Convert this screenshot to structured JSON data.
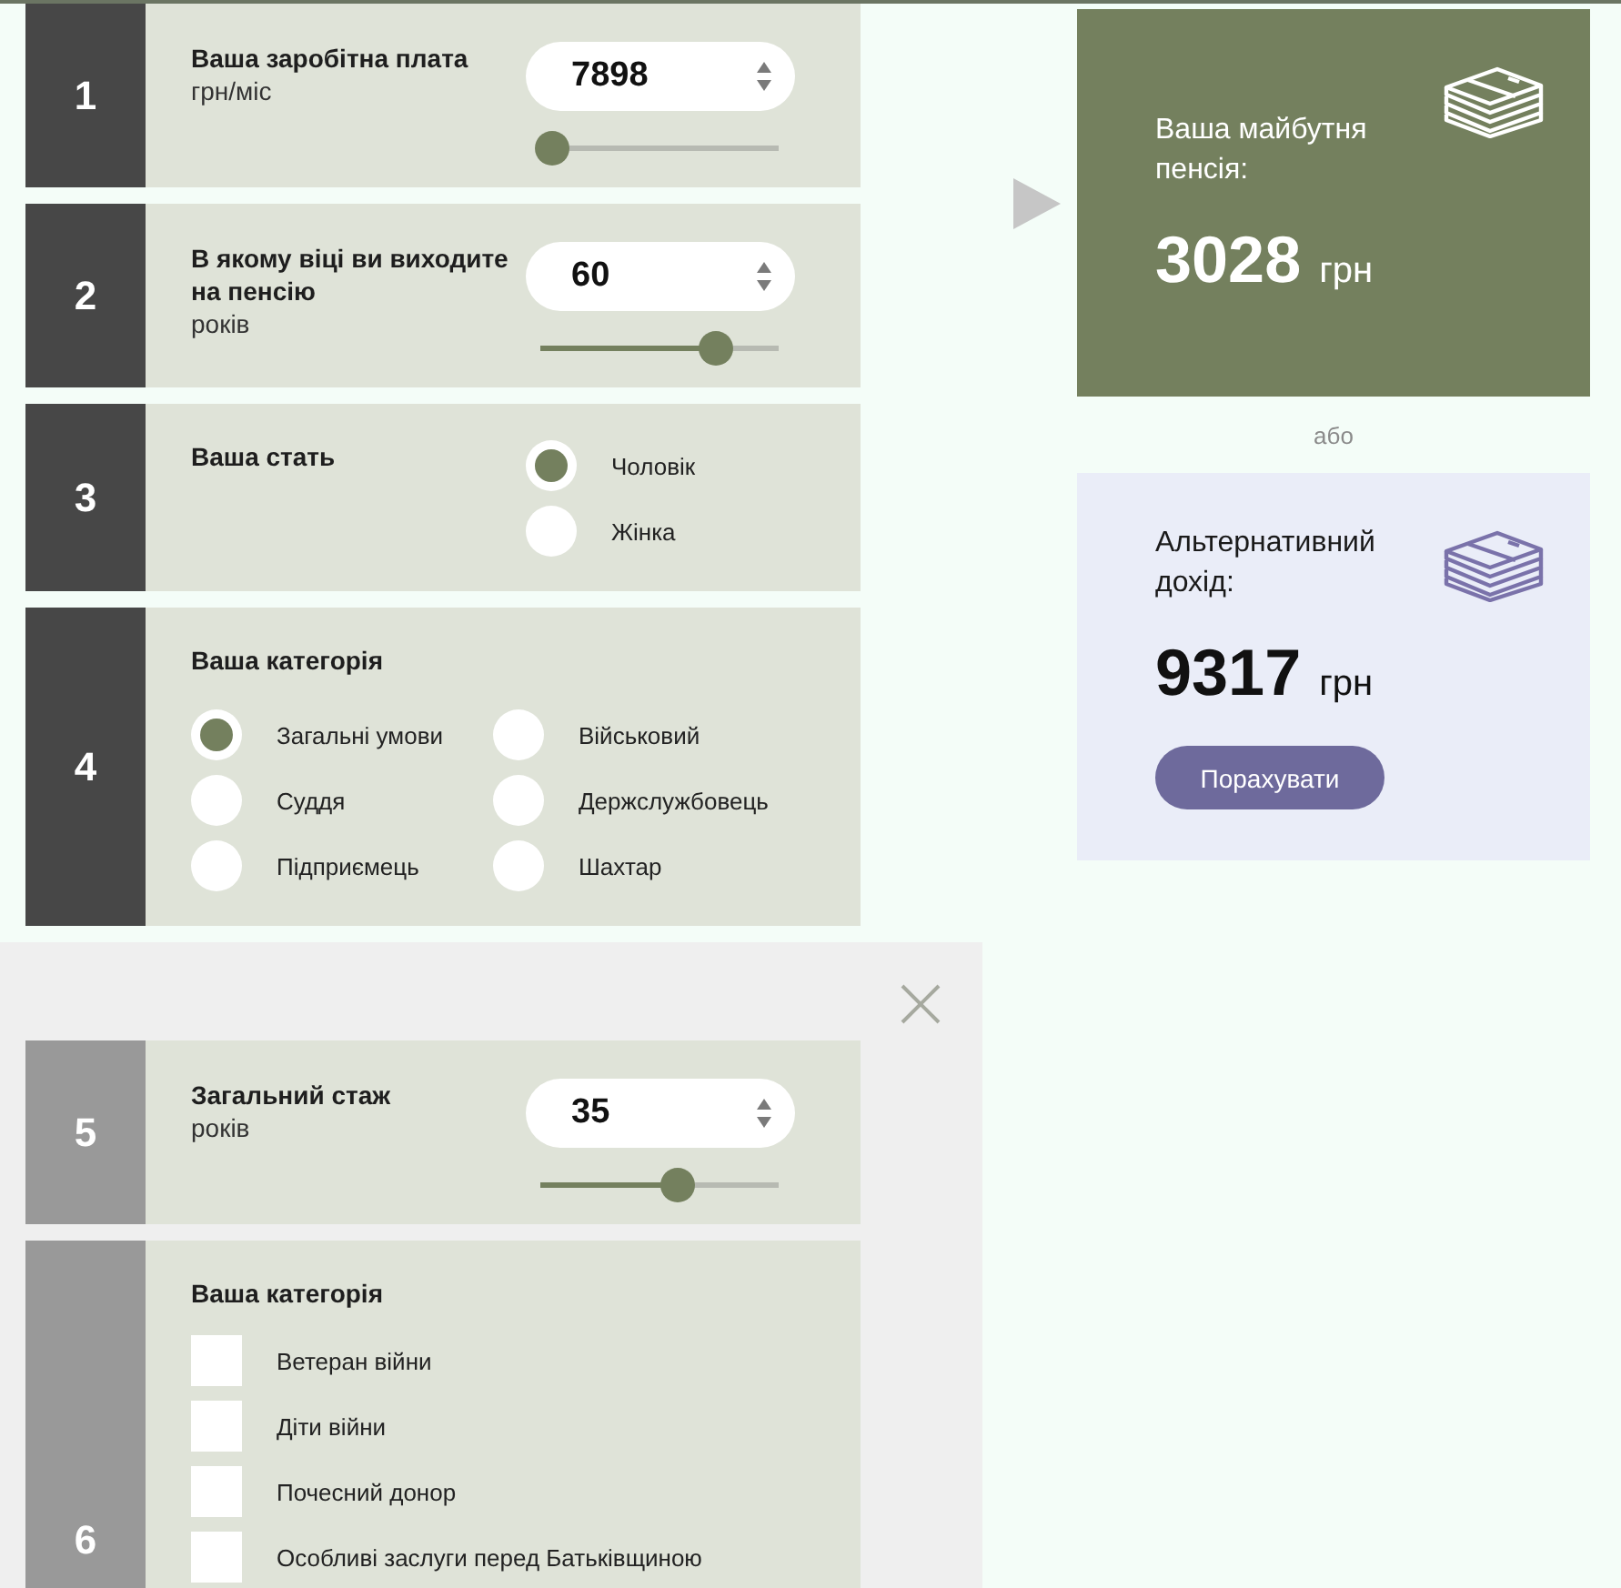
{
  "steps": [
    {
      "number": "1",
      "kind": "number_input",
      "title": "Ваша заробітна плата",
      "unit": "грн/міс",
      "value": "7898",
      "level": 0.05
    },
    {
      "number": "2",
      "kind": "number_input",
      "title": "В якому віці ви виходите на пенсію",
      "unit": "років",
      "value": "60",
      "level": 0.74
    },
    {
      "number": "3",
      "kind": "radio",
      "title": "Ваша стать",
      "options": [
        {
          "label": "Чоловік",
          "selected": true
        },
        {
          "label": "Жінка",
          "selected": false
        }
      ]
    },
    {
      "number": "4",
      "kind": "radio_grid",
      "title": "Ваша категорія",
      "options": [
        {
          "label": "Загальні умови",
          "selected": true
        },
        {
          "label": "Військовий",
          "selected": false
        },
        {
          "label": "Суддя",
          "selected": false
        },
        {
          "label": "Держслужбовець",
          "selected": false
        },
        {
          "label": "Підприємець",
          "selected": false
        },
        {
          "label": "Шахтар",
          "selected": false
        }
      ]
    }
  ],
  "overlay": {
    "steps": [
      {
        "number": "5",
        "kind": "number_input",
        "title": "Загальний стаж",
        "unit": "років",
        "value": "35",
        "level": 0.58
      },
      {
        "number": "6",
        "kind": "checkbox_list",
        "title": "Ваша категорія",
        "options": [
          {
            "label": "Ветеран війни",
            "checked": false
          },
          {
            "label": "Діти війни",
            "checked": false
          },
          {
            "label": "Почесний донор",
            "checked": false
          },
          {
            "label": "Особливі заслуги перед Батьківщиною",
            "checked": false
          }
        ]
      }
    ]
  },
  "pension": {
    "title": "Ваша майбутня пенсія:",
    "amount": "3028",
    "currency": "грн"
  },
  "or_label": "або",
  "alternative": {
    "title": "Альтернативний дохід:",
    "amount": "9317",
    "currency": "грн",
    "button": "Порахувати"
  }
}
